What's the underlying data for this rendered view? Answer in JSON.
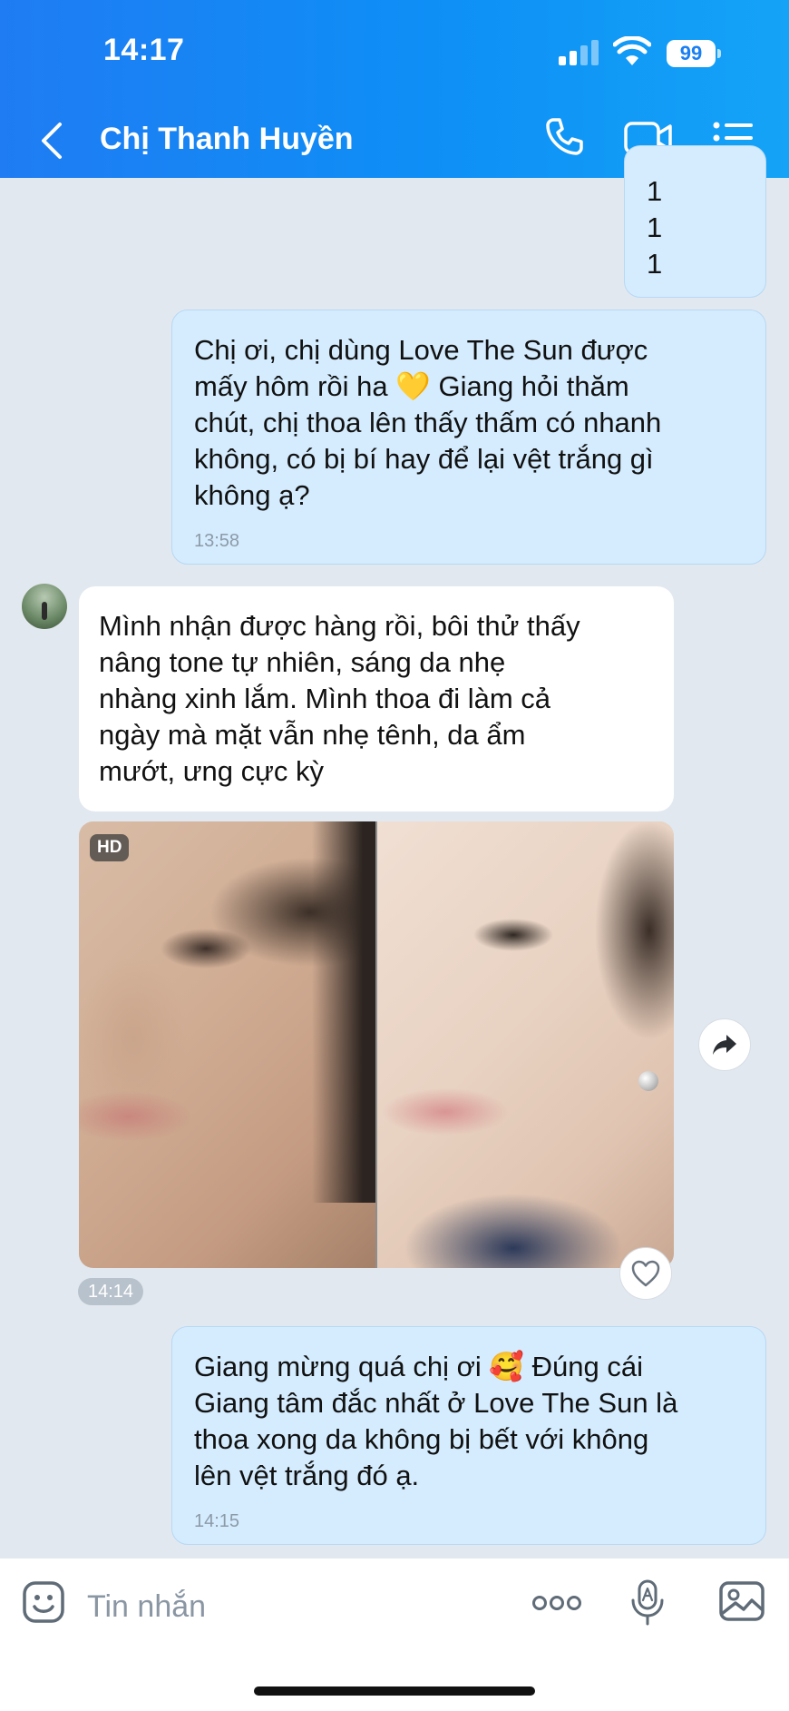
{
  "status_bar": {
    "time": "14:17",
    "battery": "99"
  },
  "header": {
    "title": "Chị Thanh Huyền"
  },
  "messages": {
    "partial_lines": [
      "1",
      "1",
      "1"
    ],
    "m1": {
      "lines": [
        "Chị ơi, chị dùng Love The Sun được",
        "mấy hôm rồi ha 💛 Giang hỏi thăm",
        "chút, chị thoa lên thấy thấm có nhanh",
        "không, có bị bí hay để lại vệt trắng gì",
        "không ạ?"
      ],
      "time": "13:58"
    },
    "m2": {
      "lines": [
        "Mình nhận được hàng rồi, bôi thử thấy",
        "nâng tone tự nhiên, sáng da nhẹ",
        "nhàng xinh lắm. Mình thoa đi làm cả",
        "ngày mà mặt vẫn nhẹ tênh, da ẩm",
        "mướt, ưng cực kỳ"
      ]
    },
    "photo": {
      "badge": "HD",
      "time": "14:14"
    },
    "m3": {
      "lines": [
        "Giang mừng quá chị ơi 🥰 Đúng cái",
        "Giang tâm đắc nhất ở Love The Sun là",
        "thoa xong da không bị bết với không",
        "lên vệt trắng đó ạ."
      ],
      "time": "14:15"
    }
  },
  "input": {
    "placeholder": "Tin nhắn"
  },
  "colors": {
    "header_start": "#1f7cf3",
    "header_end": "#14a3f7",
    "my_bubble": "#d4ecfe",
    "chat_bg": "#e2e8ef"
  },
  "icons": [
    "back-icon",
    "phone-icon",
    "video-icon",
    "list-icon",
    "share-icon",
    "heart-icon",
    "sticker-icon",
    "more-icon",
    "voice-icon",
    "gallery-icon"
  ]
}
